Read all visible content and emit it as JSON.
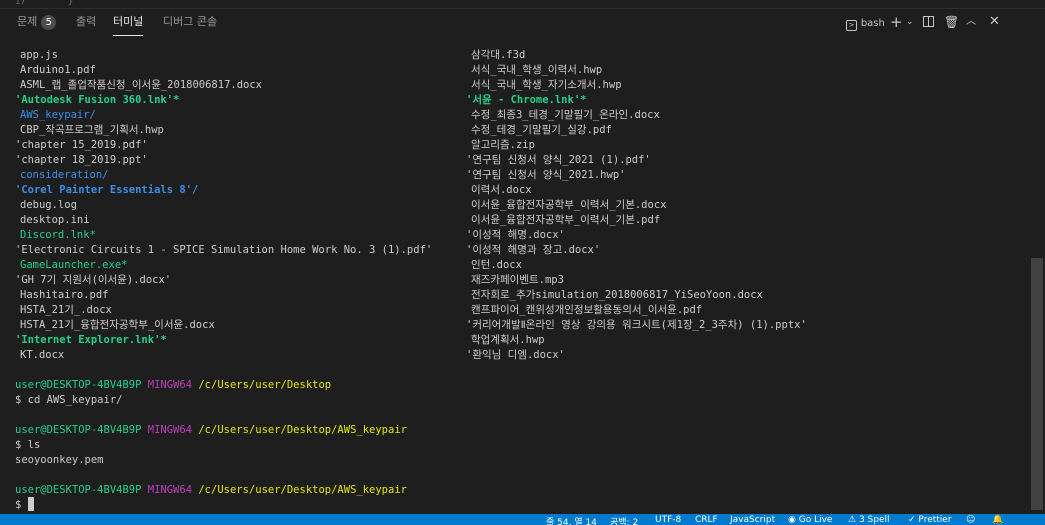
{
  "panel": {
    "tabs": [
      {
        "label": "문제",
        "badge": "5"
      },
      {
        "label": "출력"
      },
      {
        "label": "터미널"
      },
      {
        "label": "디버그 콘솔"
      }
    ],
    "shell": "bash"
  },
  "terminal": {
    "left_files": [
      "app.js",
      "Arduino1.pdf",
      "ASML_랩_졸업작품신청_이서윤_2018006817.docx",
      "'Autodesk Fusion 360.lnk'*",
      "AWS_keypair/",
      "CBP_작곡프로그램_기획서.hwp",
      "'chapter 15_2019.pdf'",
      "'chapter 18_2019.ppt'",
      "consideration/",
      "'Corel Painter Essentials 8'/",
      "debug.log",
      "desktop.ini",
      "Discord.lnk*",
      "'Electronic Circuits 1 - SPICE Simulation Home Work No. 3 (1).pdf'",
      "GameLauncher.exe*",
      "'GH 7기 지원서(이서윤).docx'",
      "Hashitairo.pdf",
      "HSTA_21기_.docx",
      "HSTA_21기_융합전자공학부_이서윤.docx",
      "'Internet Explorer.lnk'*",
      "KT.docx"
    ],
    "right_files": [
      "삼각대.f3d",
      "서식_국내_학생_이력서.hwp",
      "서식_국내_학생_자기소개서.hwp",
      "'서윤 - Chrome.lnk'*",
      "수정_최종3_테경_기말필기_온라인.docx",
      "수정_테경_기말필기_실강.pdf",
      "알고리즘.zip",
      "'연구팀 신청서 양식_2021 (1).pdf'",
      "'연구팀 신청서 양식_2021.hwp'",
      "이력서.docx",
      "이서윤_융합전자공학부_이력서_기본.docx",
      "이서윤_융합전자공학부_이력서_기본.pdf",
      "'이성적 해명.docx'",
      "'이성적 해명과 장고.docx'",
      "인턴.docx",
      "재즈카페이벤트.mp3",
      "전자회로_추가simulation_2018006817_YiSeoYoon.docx",
      "캔프파이어_캔위성개인정보활용동의서_이서윤.pdf",
      "'커리어개발Ⅱ온라인 영상 강의용 워크시트(제1장_2_3주차) (1).pptx'",
      "학업계획서.hwp",
      "'환익님 디엠.docx'"
    ],
    "prompt_user": "user@DESKTOP-4BV4B9P",
    "prompt_env": "MINGW64",
    "path1": "/c/Users/user/Desktop",
    "cmd1": "$ cd AWS_keypair/",
    "path2": "/c/Users/user/Desktop/AWS_keypair",
    "cmd2": "$ ls",
    "output2": "seoyoonkey.pem",
    "path3": "/c/Users/user/Desktop/AWS_keypair",
    "cmd3": "$ "
  },
  "statusbar": {
    "position": "줄 54, 열 14",
    "spaces": "공백: 2",
    "encoding": "UTF-8",
    "eol": "CRLF",
    "language": "JavaScript",
    "golive": "Go Live",
    "spell": "3 Spell",
    "prettier": "Prettier"
  }
}
